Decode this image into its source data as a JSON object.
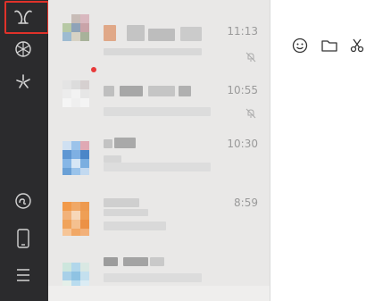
{
  "sidebar": {
    "icons": [
      "chats-icon",
      "moments-icon",
      "channels-icon",
      "mini-programs-icon",
      "phone-icon",
      "menu-icon"
    ]
  },
  "conversations": [
    {
      "time": "11:13",
      "muted": true,
      "unread_dot": false
    },
    {
      "time": "10:55",
      "muted": true,
      "unread_dot": true
    },
    {
      "time": "10:30",
      "muted": false,
      "unread_dot": false
    },
    {
      "time": "8:59",
      "muted": false,
      "unread_dot": false
    },
    {
      "time": "",
      "muted": false,
      "unread_dot": false
    }
  ],
  "toolbar": {
    "icons": [
      "emoji-icon",
      "folder-icon",
      "scissors-icon"
    ]
  },
  "colors": {
    "sidebar_bg": "#2b2b2d",
    "list_bg": "#e9e8e7",
    "highlight": "#e0322a"
  }
}
